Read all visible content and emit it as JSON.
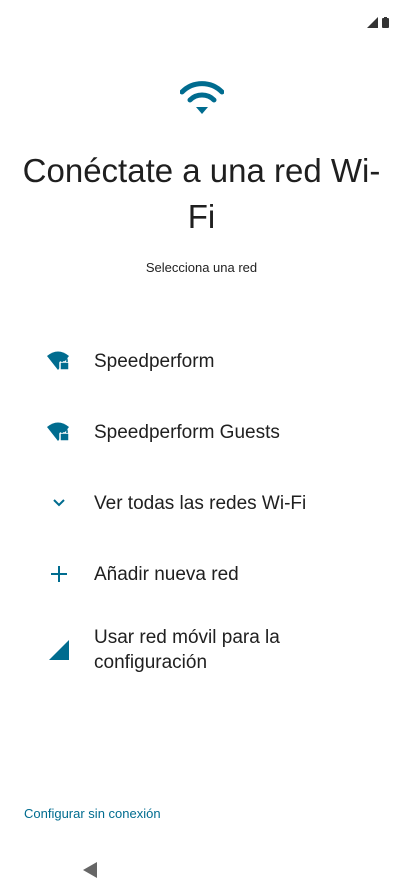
{
  "status_bar": {
    "icons": [
      "signal-icon",
      "battery-icon"
    ]
  },
  "header": {
    "icon": "wifi-icon",
    "title": "Conéctate a una red Wi-Fi",
    "subtitle": "Selecciona una red"
  },
  "networks": [
    {
      "name": "Speedperform",
      "icon": "wifi-locked-icon"
    },
    {
      "name": "Speedperform Guests",
      "icon": "wifi-locked-icon"
    }
  ],
  "actions": {
    "see_all": "Ver todas las redes Wi-Fi",
    "add_network": "Añadir nueva red",
    "use_mobile": "Usar red móvil para la configuración"
  },
  "footer": {
    "offline_setup": "Configurar sin conexión"
  },
  "colors": {
    "accent": "#006c8f",
    "text": "#1f1f1f"
  }
}
